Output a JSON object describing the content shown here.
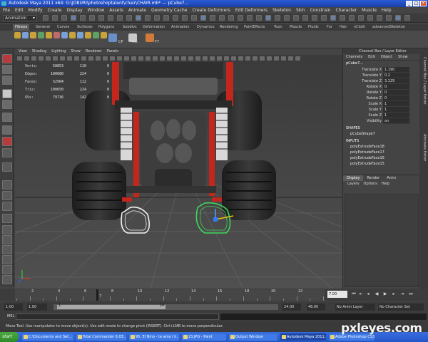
{
  "window": {
    "title": "Autodesk Maya 2011 x64: G:\\JOBURI\\photoshoptalent\\chair\\CHAIR.mb* --- pCube7..."
  },
  "menubar": [
    "File",
    "Edit",
    "Modify",
    "Create",
    "Display",
    "Window",
    "Assets",
    "Animate",
    "Geometry Cache",
    "Create Deformers",
    "Edit Deformers",
    "Skeleton",
    "Skin",
    "Constrain",
    "Character",
    "Muscle",
    "Help"
  ],
  "statusline": {
    "mode": "Animation"
  },
  "shelf": {
    "tabs": [
      "Fitness",
      "General",
      "Curves",
      "Surfaces",
      "Polygons",
      "Subdivs",
      "Deformation",
      "Animation",
      "Dynamics",
      "Rendering",
      "PaintEffects",
      "Toon",
      "Muscle",
      "Fluids",
      "Fur",
      "Hair",
      "nCloth",
      "advancedSkeleton"
    ],
    "active_tab": "Fitness",
    "icon_labels": [
      "CP",
      "His",
      "F7"
    ]
  },
  "panel_menu": [
    "View",
    "Shading",
    "Lighting",
    "Show",
    "Renderer",
    "Panels"
  ],
  "hud": {
    "rows": [
      {
        "label": "Verts:",
        "a": "50853",
        "b": "110",
        "c": "0"
      },
      {
        "label": "Edges:",
        "a": "100680",
        "b": "224",
        "c": "0"
      },
      {
        "label": "Faces:",
        "a": "52904",
        "b": "112",
        "c": "0"
      },
      {
        "label": "Tris:",
        "a": "100650",
        "b": "224",
        "c": "0"
      },
      {
        "label": "UVs:",
        "a": "79736",
        "b": "142",
        "c": "0"
      }
    ]
  },
  "channel_box": {
    "title": "Channel Box / Layer Editor",
    "menu": [
      "Channels",
      "Edit",
      "Object",
      "Show"
    ],
    "object_name": "pCube7...",
    "attributes": [
      {
        "name": "Translate X",
        "value": "1.190"
      },
      {
        "name": "Translate Y",
        "value": "0.2"
      },
      {
        "name": "Translate Z",
        "value": "3.125"
      },
      {
        "name": "Rotate X",
        "value": "0"
      },
      {
        "name": "Rotate Y",
        "value": "0"
      },
      {
        "name": "Rotate Z",
        "value": "0"
      },
      {
        "name": "Scale X",
        "value": "1"
      },
      {
        "name": "Scale Y",
        "value": "1"
      },
      {
        "name": "Scale Z",
        "value": "1"
      },
      {
        "name": "Visibility",
        "value": "on"
      }
    ],
    "shapes_header": "SHAPES",
    "shapes": [
      "pCubeShape7"
    ],
    "inputs_header": "INPUTS",
    "inputs": [
      "polyExtrudeFace18",
      "polyExtrudeFace17",
      "polyExtrudeFace16",
      "polyExtrudeFace15"
    ]
  },
  "side_tabs": [
    "Channel Box / Layer Editor",
    "Attribute Editor"
  ],
  "layer_editor": {
    "tabs": [
      "Display",
      "Render",
      "Anim"
    ],
    "active_tab": "Display",
    "menu": [
      "Layers",
      "Options",
      "Help"
    ]
  },
  "time_slider": {
    "tick_labels": [
      "2",
      "4",
      "6",
      "8",
      "10",
      "12",
      "14",
      "16",
      "18",
      "20",
      "22"
    ],
    "current_frame_marker": "7",
    "current_time": "7.00"
  },
  "range_slider": {
    "start": "1.00",
    "playback_start": "1.00",
    "handle_start": "1",
    "handle_end": "24",
    "playback_end": "24.00",
    "end": "48.00",
    "anim_layer": "No Anim Layer",
    "character_set": "No Character Set"
  },
  "command_line": {
    "label": "MEL"
  },
  "help_line": {
    "text": "Move Tool: Use manipulator to move object(s). Use edit mode to change pivot (INSERT). Ctrl+LMB to move perpendicular."
  },
  "taskbar": {
    "start": "start",
    "items": [
      "C:\\Documents and Set...",
      "Total Commander 6.03...",
      "95. El Nino - te amo i h...",
      "23.JPG - Paint",
      "Output Window",
      "Autodesk Maya 2011...",
      "Adobe Photoshop CS3..."
    ],
    "active_index": 5
  },
  "watermark": "pxleyes.com",
  "colors": {
    "accent": "#2a5ad6",
    "selection_green": "#3fd65a",
    "frame_red": "#c3261c"
  }
}
